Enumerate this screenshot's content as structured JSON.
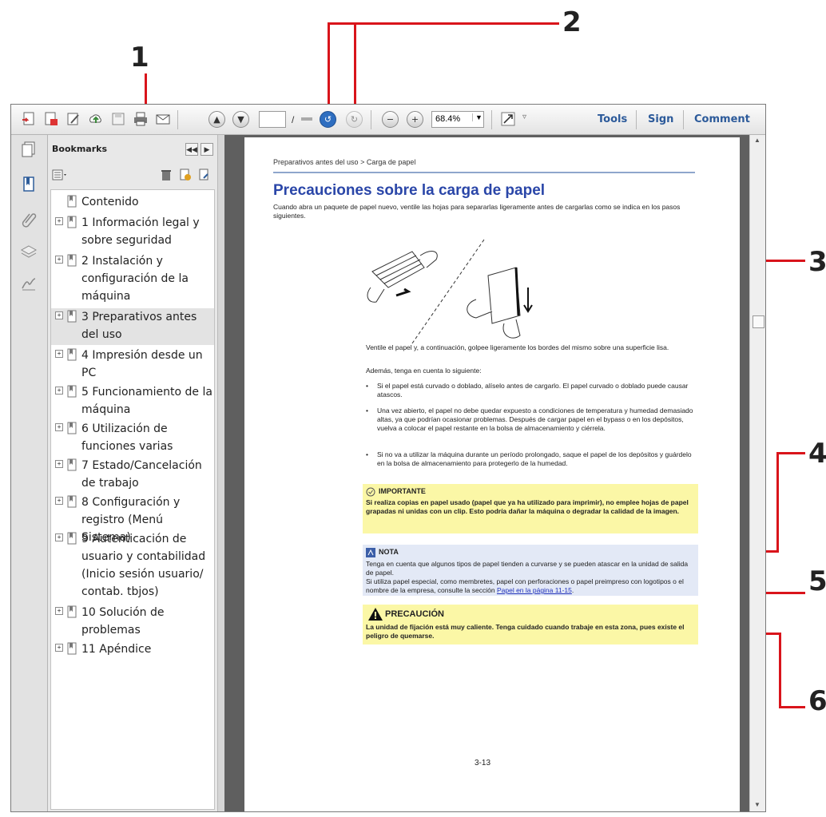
{
  "callouts": [
    "1",
    "2",
    "3",
    "4",
    "5",
    "6"
  ],
  "toolbar": {
    "page_input": "",
    "page_sep": "/",
    "page_total": "",
    "zoom": "68.4%",
    "tools_label": "Tools",
    "sign_label": "Sign",
    "comment_label": "Comment"
  },
  "bookmarks": {
    "title": "Bookmarks",
    "items": [
      {
        "label": "Contenido",
        "expandable": false
      },
      {
        "label": "1 Información legal y sobre seguridad",
        "expandable": true
      },
      {
        "label": "2 Instalación y configuración de la máquina",
        "expandable": true
      },
      {
        "label": "3 Preparativos antes del uso",
        "expandable": true,
        "selected": true
      },
      {
        "label": "4 Impresión desde un PC",
        "expandable": true
      },
      {
        "label": "5 Funcionamiento de la máquina",
        "expandable": true
      },
      {
        "label": "6 Utilización de funciones varias",
        "expandable": true
      },
      {
        "label": "7 Estado/Cancelación de trabajo",
        "expandable": true
      },
      {
        "label": "8 Configuración y registro (Menú Sistema)",
        "expandable": true
      },
      {
        "label": "9 Autenticación de usuario y contabilidad (Inicio sesión usuario/ contab. tbjos)",
        "expandable": true
      },
      {
        "label": "10 Solución de problemas",
        "expandable": true
      },
      {
        "label": "11 Apéndice",
        "expandable": true
      }
    ]
  },
  "page": {
    "breadcrumb": "Preparativos antes del uso > Carga de papel",
    "title": "Precauciones sobre la carga de papel",
    "intro": "Cuando abra un paquete de papel nuevo, ventile las hojas para separarlas ligeramente antes de cargarlas como se indica en los pasos siguientes.",
    "after_figure": "Ventile el papel y, a continuación, golpee ligeramente los bordes del mismo sobre una superficie lisa.",
    "also_note": "Además, tenga en cuenta lo siguiente:",
    "bullets": [
      "Si el papel está curvado o doblado, alíselo antes de cargarlo. El papel curvado o doblado puede causar atascos.",
      "Una vez abierto, el papel no debe quedar expuesto a condiciones de temperatura y humedad demasiado altas, ya que podrían ocasionar problemas. Después de cargar papel en el bypass o en los depósitos, vuelva a colocar el papel restante en la bolsa de almacenamiento y ciérrela.",
      "Si no va a utilizar la máquina durante un período prolongado, saque el papel de los depósitos y guárdelo en la bolsa de almacenamiento para protegerlo de la humedad."
    ],
    "important_title": "IMPORTANTE",
    "important_text": "Si realiza copias en papel usado (papel que ya ha utilizado para imprimir), no emplee hojas de papel grapadas ni unidas con un clip. Esto podría dañar la máquina o degradar la calidad de la imagen.",
    "nota_title": "NOTA",
    "nota_text1": "Tenga en cuenta que algunos tipos de papel tienden a curvarse y se pueden atascar en la unidad de salida de papel.",
    "nota_text2": "Si utiliza papel especial, como membretes, papel con perforaciones o papel preimpreso con logotipos o el nombre de la empresa, consulte la sección",
    "nota_link": "Papel en la página 11-15",
    "nota_end": ".",
    "precaucion_title": "PRECAUCIÓN",
    "precaucion_text": "La unidad de fijación está muy caliente. Tenga cuidado cuando trabaje en esta zona, pues existe el peligro de quemarse.",
    "page_number": "3-13"
  },
  "colors": {
    "callout_line": "#d9141b",
    "title_blue": "#2a46a8",
    "important_bg": "#fbf7a6",
    "nota_bg": "#e3e9f6",
    "precaucion_bg": "#fbf7a6",
    "toolbar_text": "#2c5a9a"
  }
}
